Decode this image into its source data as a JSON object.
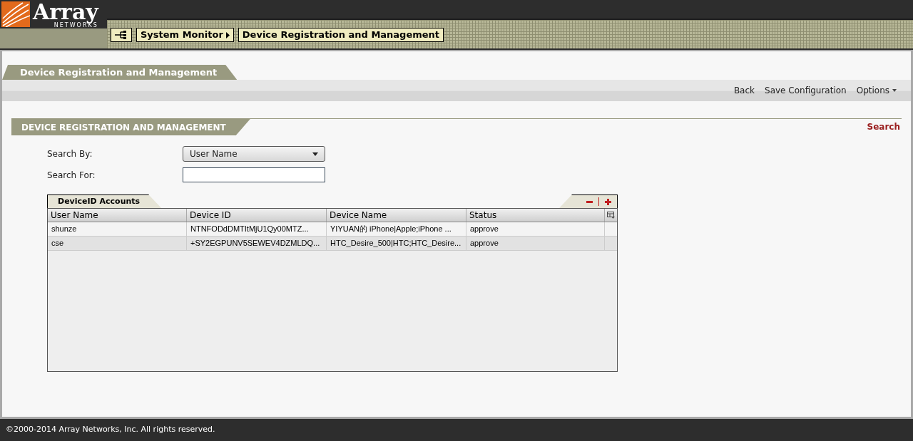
{
  "logo": {
    "name": "Array",
    "tagline": "NETWORKS"
  },
  "breadcrumb": [
    "System Monitor",
    "Device Registration and Management"
  ],
  "page_tab": "Device Registration and Management",
  "toolbar": [
    "Back",
    "Save Configuration",
    "Options"
  ],
  "section": {
    "title": "DEVICE REGISTRATION AND MANAGEMENT",
    "link": "Search"
  },
  "search_by": {
    "label": "Search By:",
    "value": "User Name"
  },
  "search_for": {
    "label": "Search For:"
  },
  "table": {
    "tab": "DeviceID Accounts",
    "columns": [
      "User Name",
      "Device ID",
      "Device Name",
      "Status"
    ],
    "rows": [
      [
        "shunze",
        "NTNFODdDMTItMjU1Qy00MTZ...",
        "YIYUAN的 iPhone|Apple;iPhone ...",
        "approve"
      ],
      [
        "cse",
        "+SY2EGPUNV5SEWEV4DZMLDQ...",
        "HTC_Desire_500|HTC;HTC_Desire...",
        "approve"
      ]
    ]
  },
  "footer": "©2000-2014 Array Networks, Inc. All rights reserved."
}
